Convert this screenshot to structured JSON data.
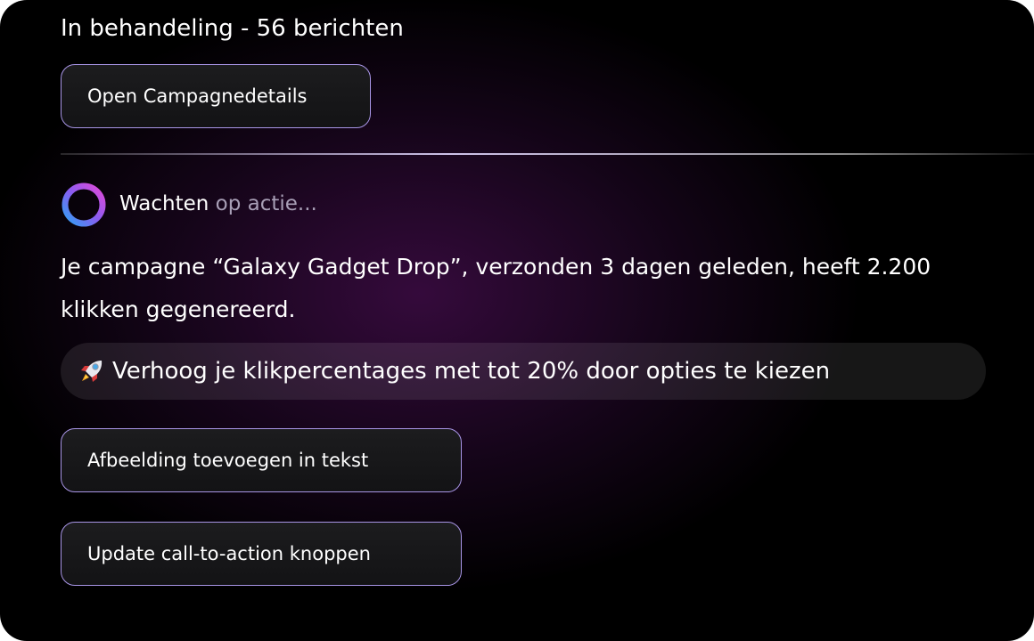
{
  "status": {
    "text": "In behandeling - 56 berichten"
  },
  "buttons": {
    "open_campaign": "Open Campagnedetails",
    "add_image": "Afbeelding toevoegen in tekst",
    "update_cta": "Update call-to-action knoppen"
  },
  "assistant": {
    "status_part1": "Wachten",
    "status_part2": " op actie...",
    "message": "Je campagne “Galaxy Gadget Drop”, verzonden 3 dagen geleden, heeft 2.200 klikken gegenereerd.",
    "tip_icon": "rocket-icon",
    "tip": "Verhoog je klikpercentages met tot 20% door opties te kiezen"
  },
  "colors": {
    "button_border": "#a895e6",
    "ring_gradient": [
      "#e24ad8",
      "#8a5cf0",
      "#2fa2f5"
    ]
  }
}
